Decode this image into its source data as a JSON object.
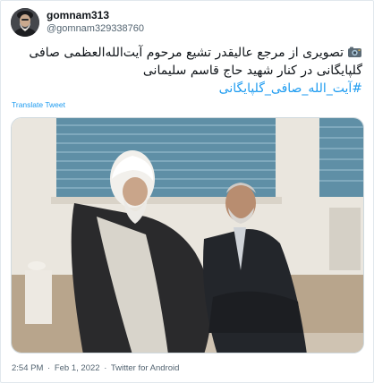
{
  "author": {
    "display_name": "gomnam313",
    "handle": "@gomnam329338760"
  },
  "tweet": {
    "text_main": "تصویری از مرجع عالیقدر تشیع مرحوم آیت‌الله‌العظمی صافی گلپایگانی در کنار شهید حاج قاسم سلیمانی",
    "hashtag": "#آیت_الله_صافی_گلپایگانی",
    "translate_label": "Translate Tweet",
    "camera_icon": "camera-flash-icon"
  },
  "meta": {
    "time": "2:54 PM",
    "separator": "·",
    "date": "Feb 1, 2022",
    "source": "Twitter for Android"
  },
  "colors": {
    "link": "#1d9bf0",
    "text": "#0f1419",
    "muted": "#536471"
  }
}
